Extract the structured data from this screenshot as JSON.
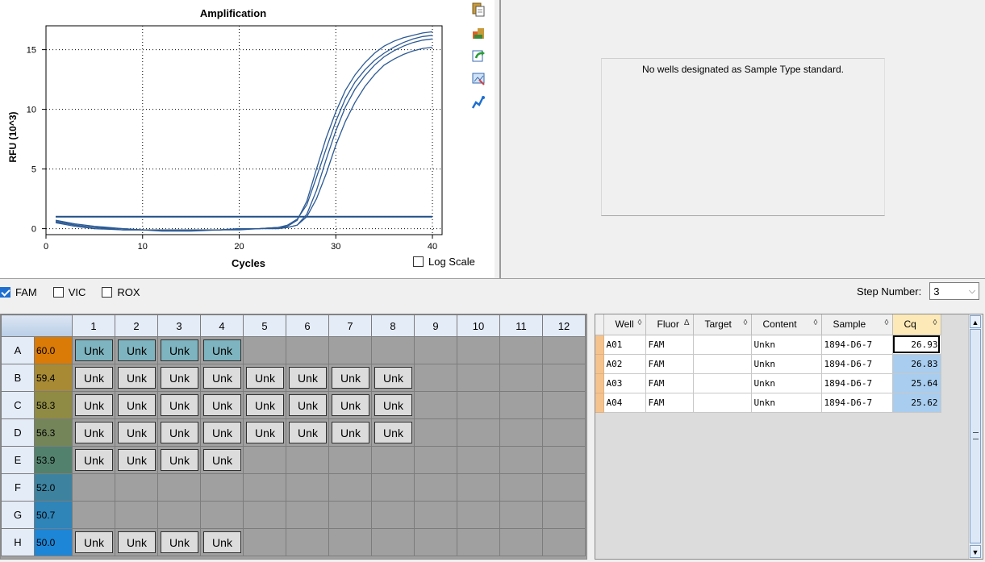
{
  "chart": {
    "title": "Amplification",
    "xlabel": "Cycles",
    "ylabel": "RFU (10^3)",
    "log_scale_label": "Log Scale",
    "log_scale_checked": false
  },
  "chart_data": {
    "type": "line",
    "title": "Amplification",
    "xlabel": "Cycles",
    "ylabel": "RFU (10^3)",
    "xlim": [
      0,
      41
    ],
    "ylim": [
      -0.5,
      17
    ],
    "xticks": [
      0,
      10,
      20,
      30,
      40
    ],
    "yticks": [
      0,
      5,
      10,
      15
    ],
    "grid": true,
    "threshold": 1.0,
    "series": [
      {
        "x": [
          1,
          3,
          5,
          8,
          10,
          12,
          15,
          18,
          20,
          22,
          24,
          25,
          26,
          27,
          28,
          29,
          30,
          31,
          32,
          33,
          34,
          35,
          36,
          37,
          38,
          39,
          40
        ],
        "values": [
          0.6,
          0.3,
          0.1,
          0.0,
          -0.1,
          -0.1,
          -0.1,
          -0.1,
          0.0,
          0.0,
          0.1,
          0.3,
          0.8,
          2.0,
          4.3,
          6.7,
          9.0,
          10.9,
          12.3,
          13.3,
          14.1,
          14.7,
          15.2,
          15.6,
          15.9,
          16.1,
          16.2
        ]
      },
      {
        "x": [
          1,
          3,
          5,
          8,
          10,
          12,
          15,
          18,
          20,
          22,
          24,
          25,
          26,
          27,
          28,
          29,
          30,
          31,
          32,
          33,
          34,
          35,
          36,
          37,
          38,
          39,
          40
        ],
        "values": [
          0.5,
          0.2,
          0.0,
          -0.1,
          -0.1,
          -0.2,
          -0.2,
          -0.1,
          -0.1,
          0.0,
          0.1,
          0.2,
          0.7,
          2.3,
          5.0,
          7.6,
          9.8,
          11.6,
          12.9,
          13.9,
          14.7,
          15.3,
          15.7,
          16.0,
          16.2,
          16.4,
          16.5
        ]
      },
      {
        "x": [
          1,
          3,
          5,
          8,
          10,
          12,
          15,
          18,
          20,
          22,
          24,
          25,
          26,
          27,
          28,
          29,
          30,
          31,
          32,
          33,
          34,
          35,
          36,
          37,
          38,
          39,
          40
        ],
        "values": [
          0.7,
          0.4,
          0.2,
          0.0,
          -0.1,
          -0.1,
          -0.1,
          -0.1,
          0.0,
          0.0,
          0.1,
          0.1,
          0.3,
          1.0,
          2.5,
          4.6,
          7.0,
          9.0,
          10.6,
          11.9,
          12.9,
          13.7,
          14.2,
          14.6,
          14.9,
          15.1,
          15.2
        ]
      },
      {
        "x": [
          1,
          3,
          5,
          8,
          10,
          12,
          15,
          18,
          20,
          22,
          24,
          25,
          26,
          27,
          28,
          29,
          30,
          31,
          32,
          33,
          34,
          35,
          36,
          37,
          38,
          39,
          40
        ],
        "values": [
          0.6,
          0.3,
          0.1,
          -0.1,
          -0.1,
          -0.1,
          -0.1,
          -0.1,
          0.0,
          0.0,
          0.0,
          0.1,
          0.3,
          1.2,
          3.2,
          5.8,
          8.2,
          10.2,
          11.7,
          12.8,
          13.7,
          14.4,
          14.9,
          15.3,
          15.6,
          15.8,
          15.9
        ]
      }
    ]
  },
  "std_curve_message": "No wells designated as Sample Type standard.",
  "fluors": [
    {
      "label": "FAM",
      "checked": true
    },
    {
      "label": "VIC",
      "checked": false
    },
    {
      "label": "ROX",
      "checked": false
    }
  ],
  "step": {
    "label": "Step Number:",
    "value": "3"
  },
  "plate": {
    "columns": [
      "1",
      "2",
      "3",
      "4",
      "5",
      "6",
      "7",
      "8",
      "9",
      "10",
      "11",
      "12"
    ],
    "rows": [
      {
        "label": "A",
        "temp": "60.0",
        "color": "#d97b06",
        "wells": [
          "Unk",
          "Unk",
          "Unk",
          "Unk",
          "",
          "",
          "",
          "",
          "",
          "",
          "",
          ""
        ],
        "selected": [
          true,
          true,
          true,
          true
        ]
      },
      {
        "label": "B",
        "temp": "59.4",
        "color": "#a78a33",
        "wells": [
          "Unk",
          "Unk",
          "Unk",
          "Unk",
          "Unk",
          "Unk",
          "Unk",
          "Unk",
          "",
          "",
          "",
          ""
        ]
      },
      {
        "label": "C",
        "temp": "58.3",
        "color": "#8f8a44",
        "wells": [
          "Unk",
          "Unk",
          "Unk",
          "Unk",
          "Unk",
          "Unk",
          "Unk",
          "Unk",
          "",
          "",
          "",
          ""
        ]
      },
      {
        "label": "D",
        "temp": "56.3",
        "color": "#74855a",
        "wells": [
          "Unk",
          "Unk",
          "Unk",
          "Unk",
          "Unk",
          "Unk",
          "Unk",
          "Unk",
          "",
          "",
          "",
          ""
        ]
      },
      {
        "label": "E",
        "temp": "53.9",
        "color": "#52826e",
        "wells": [
          "Unk",
          "Unk",
          "Unk",
          "Unk",
          "",
          "",
          "",
          "",
          "",
          "",
          "",
          ""
        ]
      },
      {
        "label": "F",
        "temp": "52.0",
        "color": "#3d83a0",
        "wells": [
          "",
          "",
          "",
          "",
          "",
          "",
          "",
          "",
          "",
          "",
          "",
          ""
        ]
      },
      {
        "label": "G",
        "temp": "50.7",
        "color": "#2f84b8",
        "wells": [
          "",
          "",
          "",
          "",
          "",
          "",
          "",
          "",
          "",
          "",
          "",
          ""
        ]
      },
      {
        "label": "H",
        "temp": "50.0",
        "color": "#1e86d6",
        "wells": [
          "Unk",
          "Unk",
          "Unk",
          "Unk",
          "",
          "",
          "",
          "",
          "",
          "",
          "",
          ""
        ]
      }
    ]
  },
  "results_table": {
    "headers": [
      {
        "label": "Well",
        "sort": "◊"
      },
      {
        "label": "Fluor",
        "sort": "Δ"
      },
      {
        "label": "Target",
        "sort": "◊"
      },
      {
        "label": "Content",
        "sort": "◊"
      },
      {
        "label": "Sample",
        "sort": "◊"
      },
      {
        "label": "Cq",
        "sort": "◊"
      }
    ],
    "rows": [
      {
        "well": "A01",
        "fluor": "FAM",
        "target": "",
        "content": "Unkn",
        "sample": "1894-D6-7",
        "cq": "26.93"
      },
      {
        "well": "A02",
        "fluor": "FAM",
        "target": "",
        "content": "Unkn",
        "sample": "1894-D6-7",
        "cq": "26.83"
      },
      {
        "well": "A03",
        "fluor": "FAM",
        "target": "",
        "content": "Unkn",
        "sample": "1894-D6-7",
        "cq": "25.64"
      },
      {
        "well": "A04",
        "fluor": "FAM",
        "target": "",
        "content": "Unkn",
        "sample": "1894-D6-7",
        "cq": "25.62"
      }
    ]
  },
  "icons": [
    "copy-icon",
    "export-icon",
    "refresh-icon",
    "zoom-icon",
    "curve-icon"
  ]
}
